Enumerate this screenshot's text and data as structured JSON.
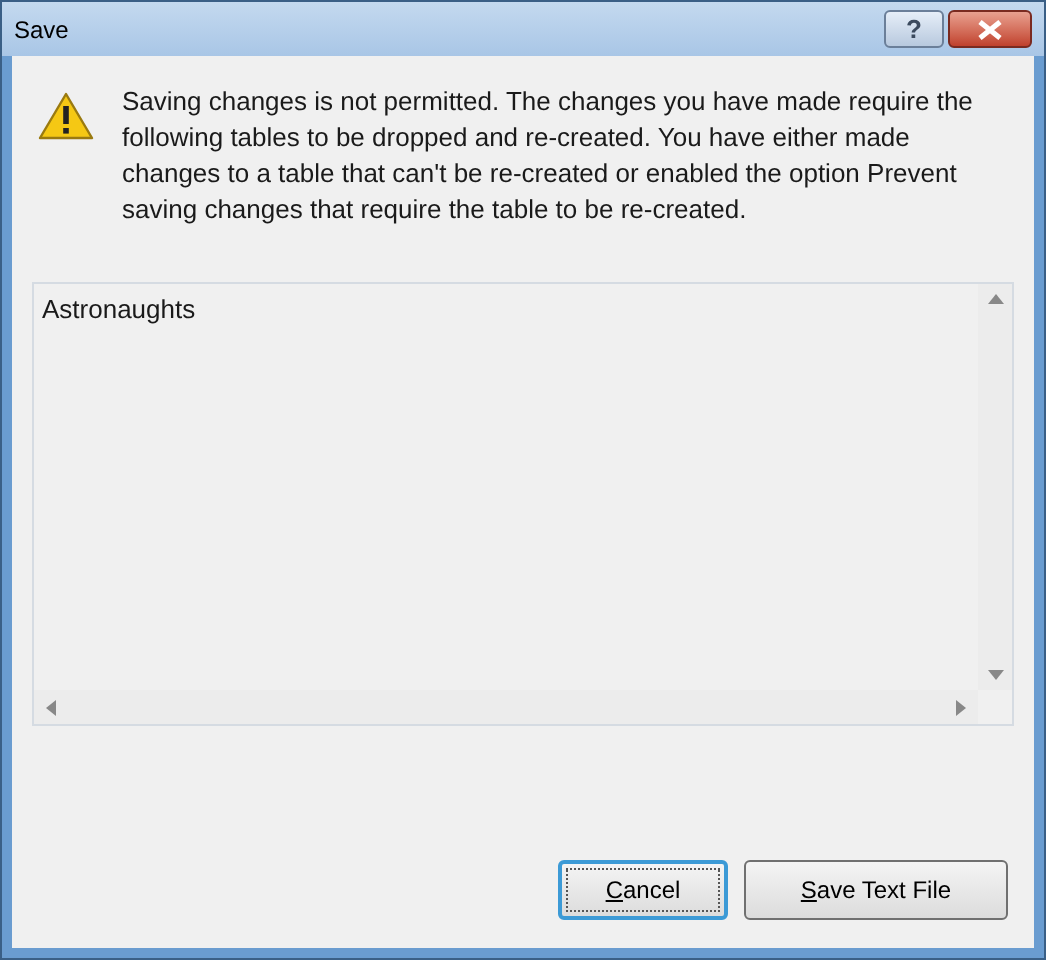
{
  "window": {
    "title": "Save",
    "title_buttons": [
      "?"
    ]
  },
  "message": "Saving changes is not permitted. The changes you have made require the following tables to be dropped and re-created. You have either made changes to a table that can't be re-created or enabled the option Prevent saving changes that require the table to be re-created.",
  "tables": [
    "Astronaughts"
  ],
  "buttons": [
    {
      "label": "Cancel",
      "focused": true,
      "access_key_first": true
    },
    {
      "label": "Save Text File",
      "focused": false,
      "access_key_first": true
    }
  ]
}
